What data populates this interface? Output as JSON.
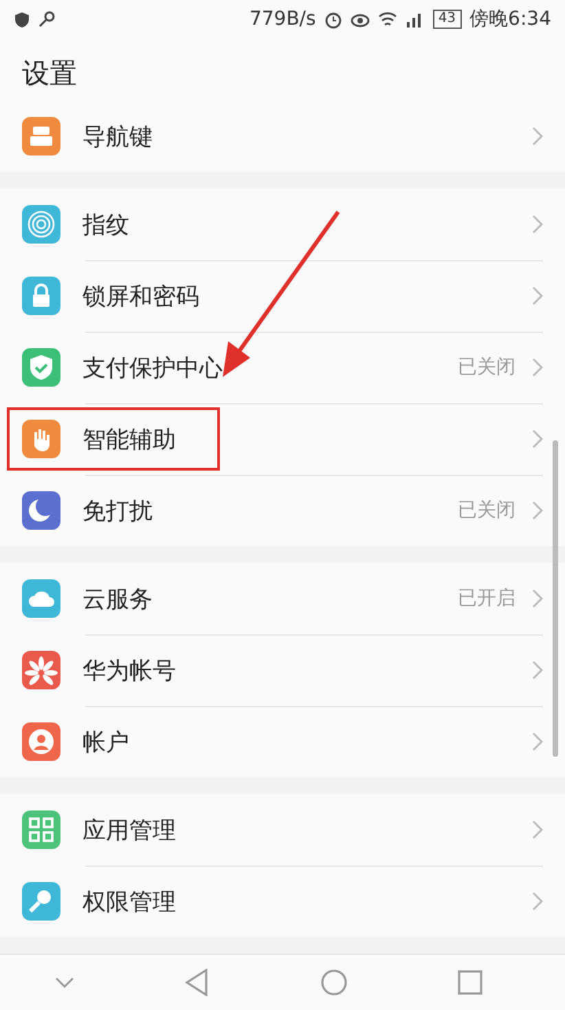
{
  "status_bar": {
    "speed": "779B/s",
    "battery": "43",
    "time": "傍晚6:34"
  },
  "title": "设置",
  "groups": [
    {
      "items": [
        {
          "kind": "nav",
          "label": "导航键",
          "highlighted": false
        }
      ]
    },
    {
      "items": [
        {
          "kind": "fingerprint",
          "label": "指纹",
          "highlighted": false
        },
        {
          "kind": "lock",
          "label": "锁屏和密码",
          "highlighted": false
        },
        {
          "kind": "shield",
          "label": "支付保护中心",
          "status": "已关闭",
          "highlighted": false
        },
        {
          "kind": "hand",
          "label": "智能辅助",
          "highlighted": true
        },
        {
          "kind": "moon",
          "label": "免打扰",
          "status": "已关闭",
          "highlighted": false
        }
      ]
    },
    {
      "items": [
        {
          "kind": "cloud",
          "label": "云服务",
          "status": "已开启",
          "highlighted": false
        },
        {
          "kind": "petals",
          "label": "华为帐号",
          "highlighted": false
        },
        {
          "kind": "person",
          "label": "帐户",
          "highlighted": false
        }
      ]
    },
    {
      "items": [
        {
          "kind": "grid",
          "label": "应用管理",
          "highlighted": false
        },
        {
          "kind": "key",
          "label": "权限管理",
          "highlighted": false
        }
      ]
    }
  ]
}
